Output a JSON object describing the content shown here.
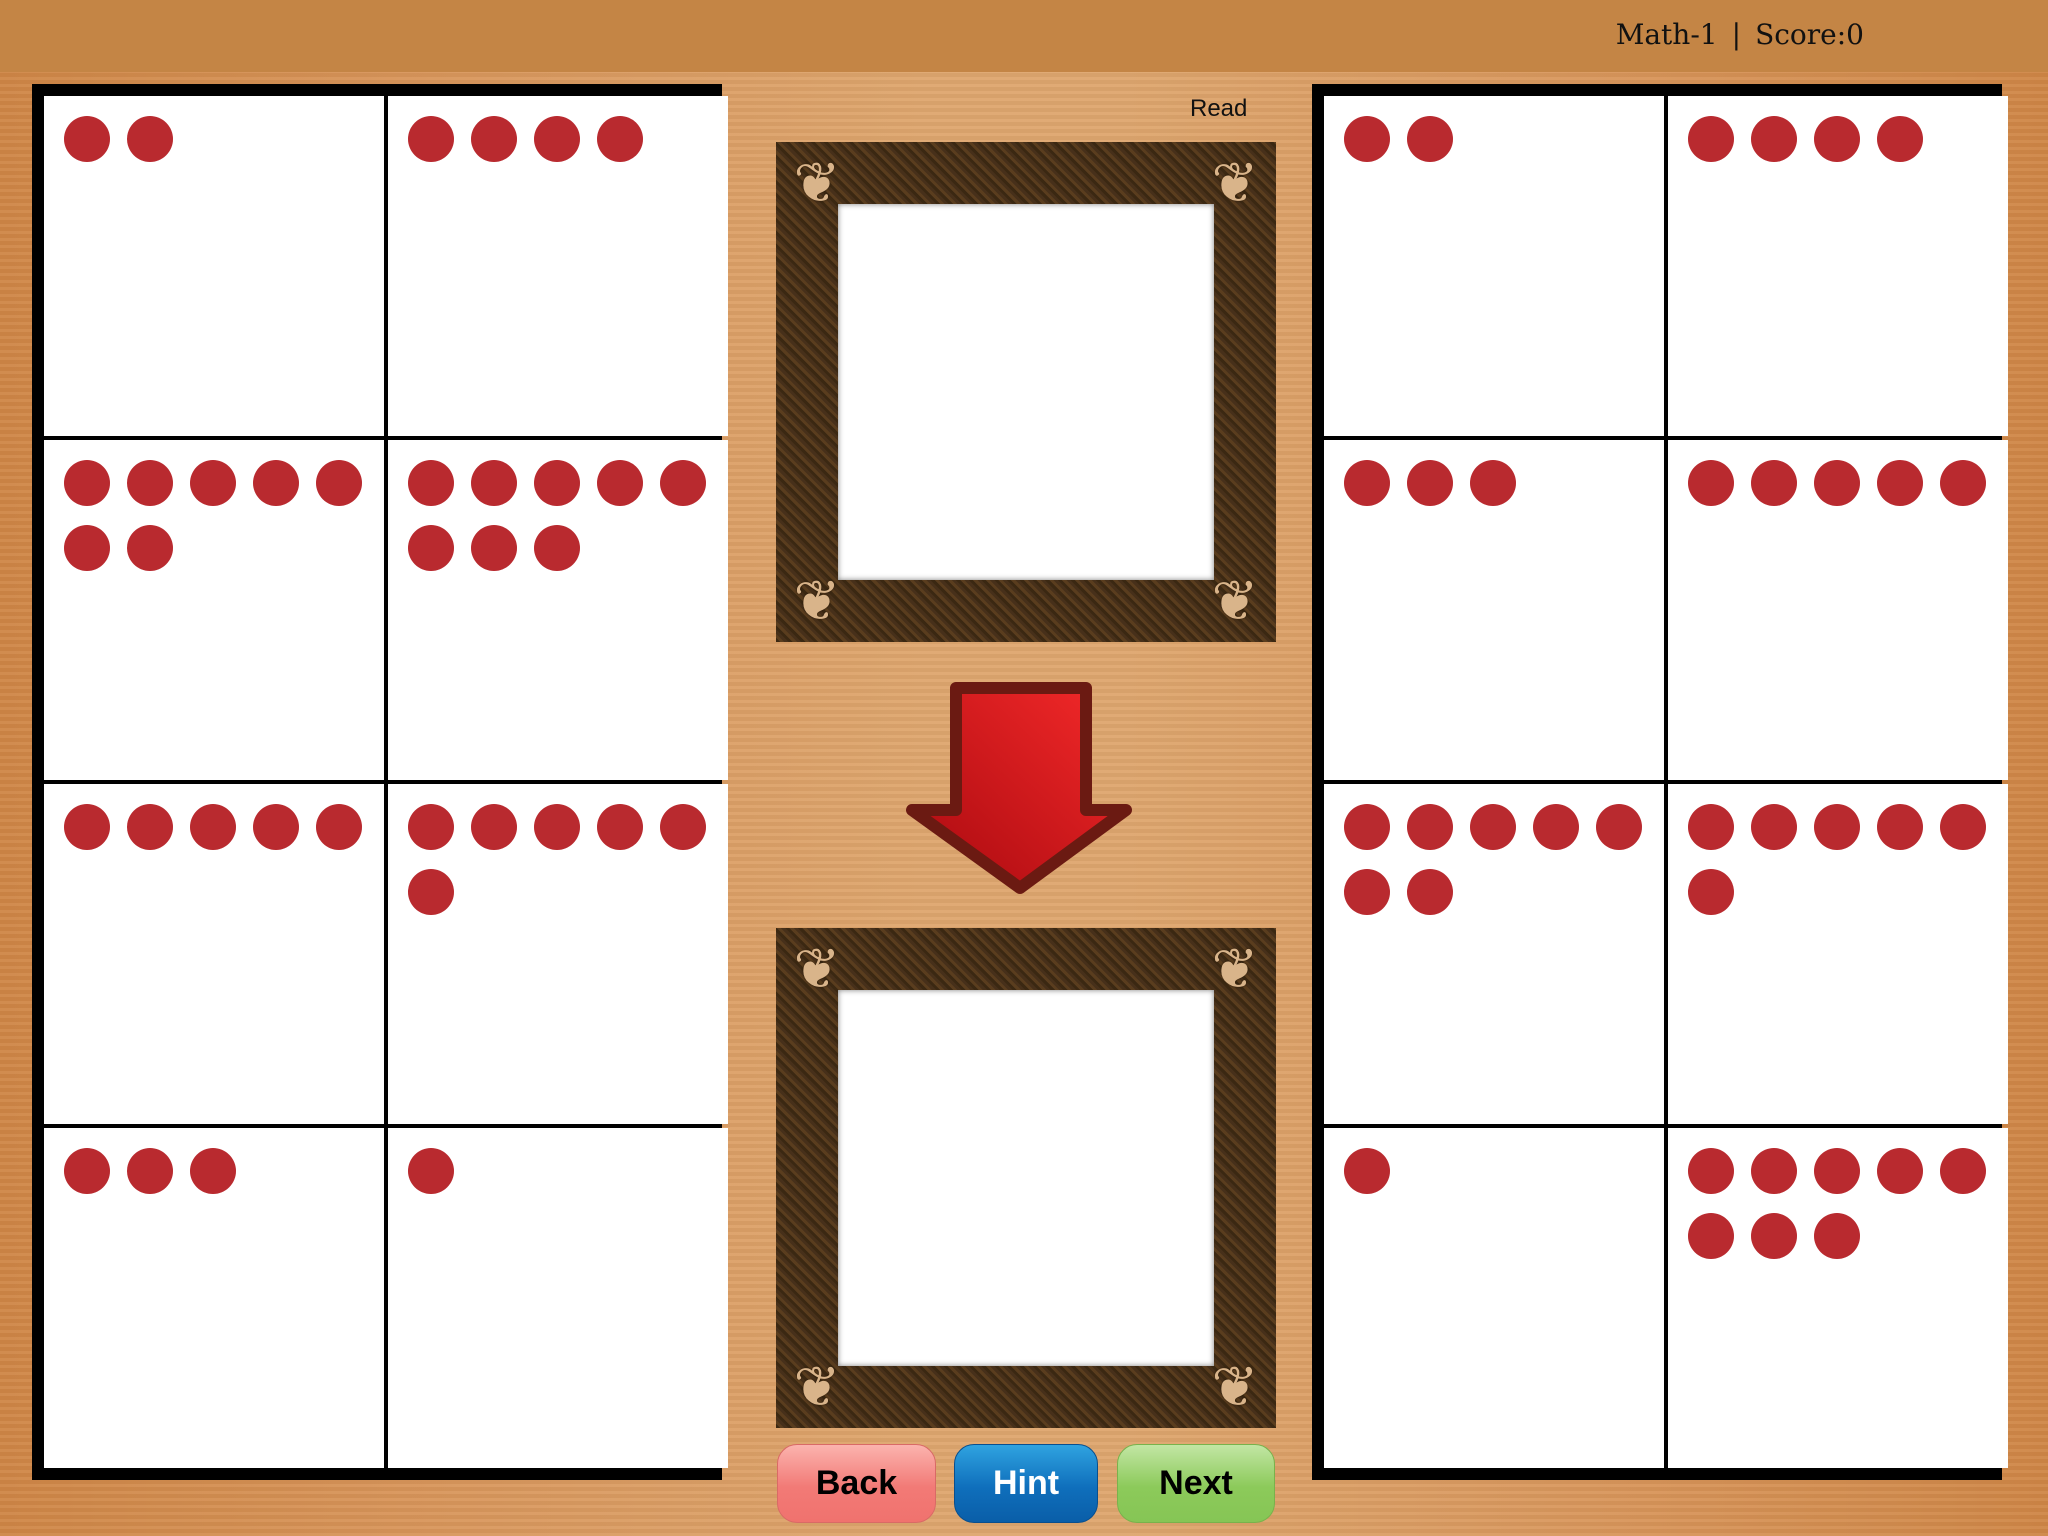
{
  "header": {
    "lesson": "Math-1",
    "separator": "|",
    "score_label": "Score:0"
  },
  "center": {
    "read_label": "Read",
    "target_frame_content": "",
    "answer_frame_content": "",
    "arrow_icon": "down-arrow-icon"
  },
  "left_panel": {
    "cells": [
      {
        "dots": 2
      },
      {
        "dots": 4
      },
      {
        "dots": 7
      },
      {
        "dots": 8
      },
      {
        "dots": 5
      },
      {
        "dots": 6
      },
      {
        "dots": 3
      },
      {
        "dots": 1
      }
    ]
  },
  "right_panel": {
    "cells": [
      {
        "dots": 2
      },
      {
        "dots": 4
      },
      {
        "dots": 3
      },
      {
        "dots": 5
      },
      {
        "dots": 7
      },
      {
        "dots": 6
      },
      {
        "dots": 1
      },
      {
        "dots": 8
      }
    ]
  },
  "buttons": {
    "back": "Back",
    "hint": "Hint",
    "next": "Next"
  },
  "colors": {
    "dot": "#b92a2f",
    "back": "#f27a76",
    "hint": "#0f6fbc",
    "next": "#8cca5a",
    "arrow": "#d41a1e"
  }
}
